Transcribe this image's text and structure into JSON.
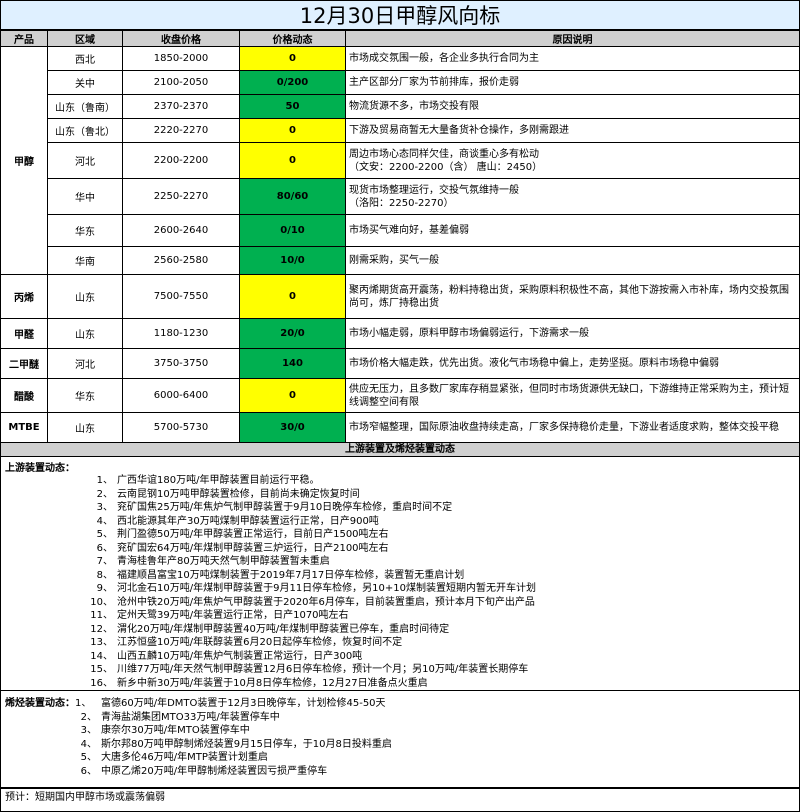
{
  "title": "12月30日甲醇风向标",
  "headers": {
    "product": "产品",
    "region": "区域",
    "price": "收盘价格",
    "change": "价格动态",
    "reason": "原因说明"
  },
  "rows": [
    {
      "product": "甲醇",
      "region": "西北",
      "price": "1850-2000",
      "change": "0",
      "change_color": "yellow",
      "reason": "市场成交氛围一般，各企业多执行合同为主"
    },
    {
      "product": "",
      "region": "关中",
      "price": "2100-2050",
      "change": "0/200",
      "change_color": "green",
      "reason": "主产区部分厂家为节前排库，报价走弱"
    },
    {
      "product": "",
      "region": "山东（鲁南）",
      "price": "2370-2370",
      "change": "50",
      "change_color": "green",
      "reason": "物流货源不多，市场交投有限"
    },
    {
      "product": "",
      "region": "山东（鲁北）",
      "price": "2220-2270",
      "change": "0",
      "change_color": "yellow",
      "reason": "下游及贸易商暂无大量备货补仓操作，多刚需跟进"
    },
    {
      "product": "",
      "region": "河北",
      "price": "2200-2200",
      "change": "0",
      "change_color": "yellow",
      "reason": "周边市场心态同样欠佳，商谈重心多有松动",
      "reason2": "（文安：2200-2200（含）  唐山：2450）"
    },
    {
      "product": "",
      "region": "华中",
      "price": "2250-2270",
      "change": "80/60",
      "change_color": "green",
      "reason": "现货市场整理运行，交投气氛维持一般",
      "reason2": "（洛阳：2250-2270）"
    },
    {
      "product": "",
      "region": "华东",
      "price": "2600-2640",
      "change": "0/10",
      "change_color": "green",
      "reason": "市场买气难向好，基差偏弱"
    },
    {
      "product": "",
      "region": "华南",
      "price": "2560-2580",
      "change": "10/0",
      "change_color": "green",
      "reason": "刚需采购，买气一般"
    },
    {
      "product": "丙烯",
      "region": "山东",
      "price": "7500-7550",
      "change": "0",
      "change_color": "yellow",
      "reason": "聚丙烯期货高开震荡，粉料持稳出货，采购原料积极性不高，其他下游按需入市补库，场内交投氛围尚可，炼厂持稳出货"
    },
    {
      "product": "甲醛",
      "region": "山东",
      "price": "1180-1230",
      "change": "20/0",
      "change_color": "green",
      "reason": "市场小幅走弱，原料甲醇市场偏弱运行，下游需求一般"
    },
    {
      "product": "二甲醚",
      "region": "河北",
      "price": "3750-3750",
      "change": "140",
      "change_color": "green",
      "reason": "市场价格大幅走跌，优先出货。液化气市场稳中偏上，走势坚挺。原料市场稳中偏弱"
    },
    {
      "product": "醋酸",
      "region": "华东",
      "price": "6000-6400",
      "change": "0",
      "change_color": "yellow",
      "reason": "供应无压力，且多数厂家库存稍显紧张，但同时市场货源供无缺口，下游维持正常采购为主，预计短线调整空间有限"
    },
    {
      "product": "MTBE",
      "region": "山东",
      "price": "5700-5730",
      "change": "30/0",
      "change_color": "green",
      "reason": "市场窄幅整理，国际原油收盘持续走高，厂家多保持稳价走量，下游业者适度求购，整体交投平稳"
    }
  ],
  "section_header": "上游装置及烯烃装置动态",
  "upstream": {
    "label": "上游装置动态：",
    "items": [
      {
        "num": "1、",
        "text": "广西华谊180万吨/年甲醇装置目前运行平稳。"
      },
      {
        "num": "2、",
        "text": "云南昆钢10万吨甲醇装置检修，目前尚未确定恢复时间"
      },
      {
        "num": "3、",
        "text": "兖矿国焦25万吨/年焦炉气制甲醇装置于9月10日晚停车检修，重启时间不定"
      },
      {
        "num": "4、",
        "text": "西北能源其年产30万吨煤制甲醇装置运行正常，日产900吨"
      },
      {
        "num": "5、",
        "text": "荆门盈德50万吨/年甲醇装置正常运行，目前日产1500吨左右"
      },
      {
        "num": "6、",
        "text": "兖矿国宏64万吨/年煤制甲醇装置三炉运行，日产2100吨左右"
      },
      {
        "num": "7、",
        "text": "青海桂鲁年产80万吨天然气制甲醇装置暂未重启"
      },
      {
        "num": "8、",
        "text": "福建顺昌富宝10万吨煤制装置于2019年7月17日停车检修，装置暂无重启计划"
      },
      {
        "num": "9、",
        "text": "河北金石10万吨/年煤制甲醇装置于9月11日停车检修，另10+10煤制装置短期内暂无开车计划"
      },
      {
        "num": "10、",
        "text": "沧州中铁20万吨/年焦炉气甲醇装置于2020年6月停车，目前装置重启，预计本月下旬产出产品"
      },
      {
        "num": "11、",
        "text": "定州天鹭39万吨/年装置运行正常，日产1070吨左右"
      },
      {
        "num": "12、",
        "text": "渭化20万吨/年煤制甲醇装置40万吨/年煤制甲醇装置已停车，重启时间待定"
      },
      {
        "num": "13、",
        "text": "江苏恒盛10万吨/年联醇装置6月20日起停车检修，恢复时间不定"
      },
      {
        "num": "14、",
        "text": "山西五麟10万吨/年焦炉气制装置正常运行，日产300吨"
      },
      {
        "num": "15、",
        "text": "川维77万吨/年天然气制甲醇装置12月6日停车检修，预计一个月；另10万吨/年装置长期停车"
      },
      {
        "num": "16、",
        "text": "新乡中新30万吨/年装置于10月8日停车检修，12月27日准备点火重启"
      }
    ]
  },
  "olefin": {
    "label": "烯烃装置动态：",
    "items": [
      {
        "num": "1、",
        "text": "富德60万吨/年DMTO装置于12月3日晚停车，计划检修45-50天"
      },
      {
        "num": "2、",
        "text": "青海盐湖集团MTO33万吨/年装置停车中"
      },
      {
        "num": "3、",
        "text": "康奈尔30万吨/年MTO装置停车中"
      },
      {
        "num": "4、",
        "text": "斯尔邦80万吨甲醇制烯烃装置9月15日停车，于10月8日投料重启"
      },
      {
        "num": "5、",
        "text": "大唐多伦46万吨/年MTP装置计划重启"
      },
      {
        "num": "6、",
        "text": "中原乙烯20万吨/年甲醇制烯烃装置因亏损严重停车"
      }
    ]
  },
  "forecast": "预计：短期国内甲醇市场或震荡偏弱",
  "colors": {
    "yellow": "#ffff00",
    "green": "#00b050",
    "header": "#d0d0d0",
    "title_bg": "#dff0ff"
  }
}
